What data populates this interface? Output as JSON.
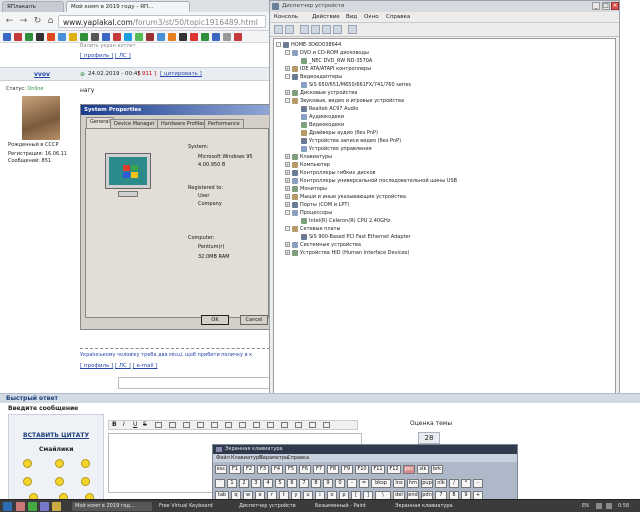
{
  "browser": {
    "tabs": [
      "ЯПлакалъ",
      "Мой комп в 2019 году - ЯП..."
    ],
    "url_host": "www.yaplakal.com",
    "url_path": "/forum3/st/50/topic1916489.html"
  },
  "forum": {
    "top_text": "Валить укран котлет",
    "links": [
      "[ профиль ]",
      "[ ЛС ]"
    ],
    "author": "vvov",
    "post_date": "24.02.2019 - 00:45",
    "post_num": "[ 911 ]",
    "quote_link": "[ цитировать ]",
    "status_label": "Статус:",
    "status_value": "Online",
    "post_text": "нагу",
    "user_rank": "Рожденный в СССР",
    "reg_label": "Регистрация:",
    "reg_date": "16.06.11",
    "msgs_label": "Сообщений:",
    "msgs_count": "851",
    "footer_text": "Українському чоловіку треба два місці, щоб прибити поличку в к",
    "footer_links": [
      "[ профиль ]",
      "[ ЛС ]",
      "[ e-mail ]"
    ]
  },
  "sysprops": {
    "title": "System Properties",
    "tabs": [
      "General",
      "Device Manager",
      "Hardware Profiles",
      "Performance"
    ],
    "system_label": "System:",
    "system_value1": "Microsoft Windows 95",
    "system_value2": "4.00.950 B",
    "registered_label": "Registered to:",
    "user": "User",
    "company": "Company",
    "computer_label": "Computer:",
    "cpu": "Pentium(r)",
    "ram": "32.0MB RAM",
    "ok": "OK",
    "cancel": "Cancel"
  },
  "devmgr": {
    "title": "Диспетчер устройств",
    "menu": [
      "Консоль",
      "Действие",
      "Вид",
      "Окно",
      "Справка"
    ],
    "tree": [
      {
        "lvl": 0,
        "exp": "-",
        "t": "HOME-3D6D038644"
      },
      {
        "lvl": 1,
        "exp": "-",
        "t": "DVD и CD-ROM дисководы"
      },
      {
        "lvl": 2,
        "exp": "",
        "t": "_NEC DVD_RW ND-3570A"
      },
      {
        "lvl": 1,
        "exp": "+",
        "t": "IDE ATA/ATAPI контроллеры"
      },
      {
        "lvl": 1,
        "exp": "-",
        "t": "Видеоадаптеры"
      },
      {
        "lvl": 2,
        "exp": "",
        "t": "SiS 650/651/M650/661FX/741/760 series"
      },
      {
        "lvl": 1,
        "exp": "+",
        "t": "Дисковые устройства"
      },
      {
        "lvl": 1,
        "exp": "-",
        "t": "Звуковые, видео и игровые устройства"
      },
      {
        "lvl": 2,
        "exp": "",
        "t": "Realtek AC97 Audio"
      },
      {
        "lvl": 2,
        "exp": "",
        "t": "Аудиокодеки"
      },
      {
        "lvl": 2,
        "exp": "",
        "t": "Видеокодеки"
      },
      {
        "lvl": 2,
        "exp": "",
        "t": "Драйверы аудио (без PnP)"
      },
      {
        "lvl": 2,
        "exp": "",
        "t": "Устройства записи видео (без PnP)"
      },
      {
        "lvl": 2,
        "exp": "",
        "t": "Устройство управления"
      },
      {
        "lvl": 1,
        "exp": "+",
        "t": "Клавиатуры"
      },
      {
        "lvl": 1,
        "exp": "+",
        "t": "Компьютер"
      },
      {
        "lvl": 1,
        "exp": "+",
        "t": "Контроллеры гибких дисков"
      },
      {
        "lvl": 1,
        "exp": "+",
        "t": "Контроллеры универсальной последовательной шины USB"
      },
      {
        "lvl": 1,
        "exp": "+",
        "t": "Мониторы"
      },
      {
        "lvl": 1,
        "exp": "+",
        "t": "Мыши и иные указывающие устройства"
      },
      {
        "lvl": 1,
        "exp": "+",
        "t": "Порты (COM и LPT)"
      },
      {
        "lvl": 1,
        "exp": "-",
        "t": "Процессоры"
      },
      {
        "lvl": 2,
        "exp": "",
        "t": "Intel(R) Celeron(R) CPU 2.40GHz"
      },
      {
        "lvl": 1,
        "exp": "-",
        "t": "Сетевые платы"
      },
      {
        "lvl": 2,
        "exp": "",
        "t": "SiS 900-Based PCI Fast Ethernet Adapter"
      },
      {
        "lvl": 1,
        "exp": "+",
        "t": "Системные устройства"
      },
      {
        "lvl": 1,
        "exp": "+",
        "t": "Устройства HID (Human Interface Devices)"
      }
    ]
  },
  "reply": {
    "quick_reply": "Быстрый ответ",
    "enter_message": "Введите сообщение",
    "insert_quote": "ВСТАВИТЬ ЦИТАТУ",
    "smilies": "Смайлики",
    "rate_topic": "Оценка темы",
    "rating": "28"
  },
  "keyboard": {
    "title": "Экранная клавиатура",
    "menu": [
      "Файл",
      "Клавиатура",
      "Параметры",
      "Справка"
    ],
    "row1": [
      "esc",
      "F1",
      "F2",
      "F3",
      "F4",
      "F5",
      "F6",
      "F7",
      "F8",
      "F9",
      "F10",
      "F11",
      "F12",
      "psc",
      "slk",
      "brk"
    ],
    "row2": [
      "`",
      "1",
      "2",
      "3",
      "4",
      "5",
      "6",
      "7",
      "8",
      "9",
      "0",
      "-",
      "=",
      "bksp",
      "ins",
      "hm",
      "pup",
      "nlk",
      "/",
      "*",
      "-"
    ],
    "row3": [
      "tab",
      "q",
      "w",
      "e",
      "r",
      "t",
      "y",
      "u",
      "i",
      "o",
      "p",
      "[",
      "]",
      "\\",
      "del",
      "end",
      "pdn",
      "7",
      "8",
      "9",
      "+"
    ]
  },
  "taskbar": {
    "tasks": [
      "Мой комп в 2019 год...",
      "Free Virtual Keyboard",
      "Диспетчер устройств",
      "Безымянный - Paint",
      "Экранная клавиатура"
    ],
    "lang": "EN",
    "time": "0:58"
  }
}
